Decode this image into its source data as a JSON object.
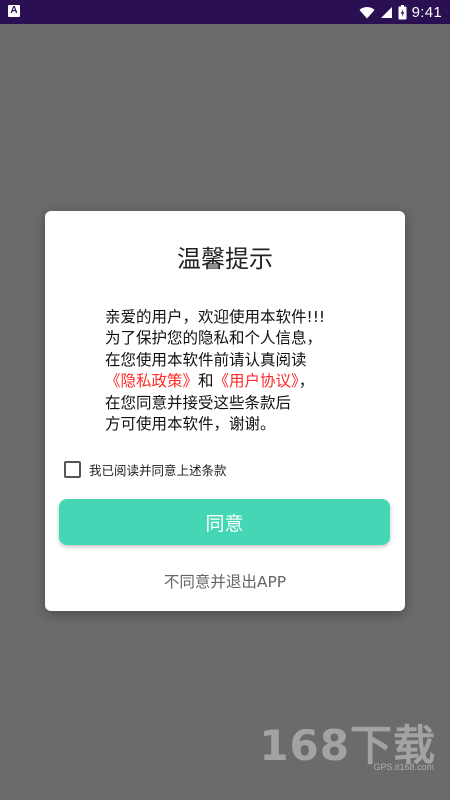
{
  "status_bar": {
    "left_icon_glyph": "A",
    "time": "9:41",
    "background": "#2a0f52",
    "icons": [
      "android-notification-icon",
      "wifi-icon",
      "signal-icon",
      "battery-icon"
    ]
  },
  "dialog": {
    "title": "温馨提示",
    "body": {
      "line1": "亲爱的用户，欢迎使用本软件!!!",
      "line2": "为了保护您的隐私和个人信息，",
      "line3": "在您使用本软件前请认真阅读",
      "privacy_link": "《隐私政策》",
      "and_text": "和",
      "agreement_link": "《用户协议》",
      "line4_suffix": "，",
      "line5": "在您同意并接受这些条款后",
      "line6": "方可使用本软件，谢谢。"
    },
    "agree_checkbox": {
      "label": "我已阅读并同意上述条款",
      "checked": false
    },
    "agree_button": "同意",
    "exit_link": "不同意并退出APP"
  },
  "colors": {
    "overlay": "#6b6b6b",
    "accent": "#45d6b6",
    "link": "#ff2a2a"
  },
  "watermark": {
    "main": "168下载",
    "sub": "GPS.it168.com"
  }
}
